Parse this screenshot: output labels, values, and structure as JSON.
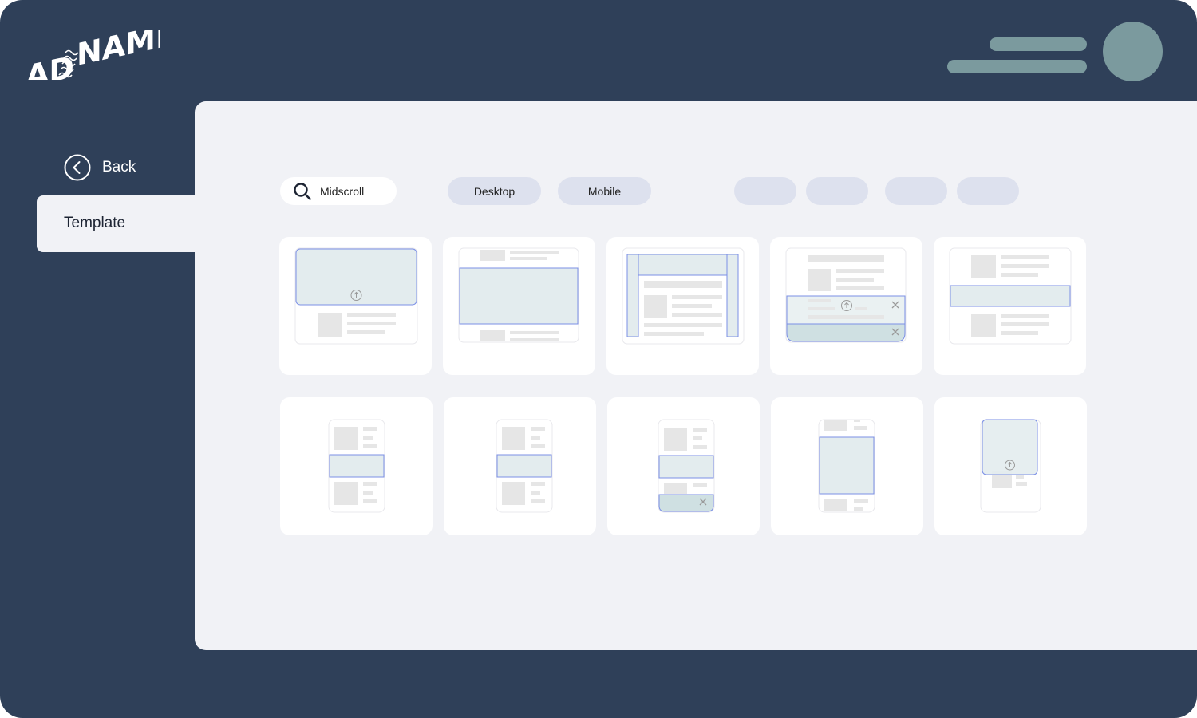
{
  "brand": {
    "logo_text": "AD NAMI"
  },
  "sidebar": {
    "back_label": "Back",
    "active_item": "Template"
  },
  "filters": {
    "search_value": "Midscroll",
    "platforms": [
      "Desktop",
      "Mobile"
    ],
    "extra_chip_count": 4
  },
  "templates": {
    "rows": [
      [
        "desktop-top-overlay",
        "desktop-inline-banner",
        "desktop-skin-frame",
        "desktop-sticky-bottom",
        "desktop-midscroll-strip"
      ],
      [
        "mobile-inline-banner",
        "mobile-inline-banner-alt",
        "mobile-sticky-bottom",
        "mobile-interstitial",
        "mobile-top-overlay"
      ]
    ]
  },
  "colors": {
    "app_bg": "#2f4059",
    "panel_bg": "#f1f2f6",
    "accent_teal": "#7b9a9e",
    "chip_bg": "#dde1ee",
    "ad_fill": "#e3ecee",
    "ad_border": "#7b8fe6",
    "placeholder_gray": "#e6e6e6"
  }
}
